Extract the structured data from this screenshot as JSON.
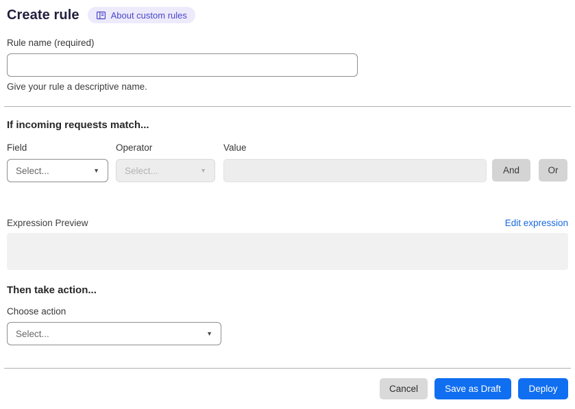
{
  "header": {
    "title": "Create rule",
    "about_badge_label": "About custom rules"
  },
  "rule_name": {
    "label": "Rule name (required)",
    "value": "",
    "helper": "Give your rule a descriptive name."
  },
  "match_section": {
    "heading": "If incoming requests match...",
    "field": {
      "label": "Field",
      "selected": "Select..."
    },
    "operator": {
      "label": "Operator",
      "selected": "Select..."
    },
    "value": {
      "label": "Value",
      "value": ""
    },
    "and_button_label": "And",
    "or_button_label": "Or"
  },
  "expression": {
    "label": "Expression Preview",
    "edit_link_label": "Edit expression",
    "preview_text": ""
  },
  "action_section": {
    "heading": "Then take action...",
    "choose_label": "Choose action",
    "selected": "Select..."
  },
  "footer": {
    "cancel_label": "Cancel",
    "save_draft_label": "Save as Draft",
    "deploy_label": "Deploy"
  },
  "icons": {
    "about_badge_icon": "book-icon",
    "dropdown_caret": "▼"
  },
  "colors": {
    "badge_bg": "#eceafb",
    "badge_text": "#4b44c8",
    "link_blue": "#1767df",
    "primary_blue": "#106ef0",
    "disabled_bg": "#ededed",
    "preview_bg": "#f1f1f1"
  }
}
